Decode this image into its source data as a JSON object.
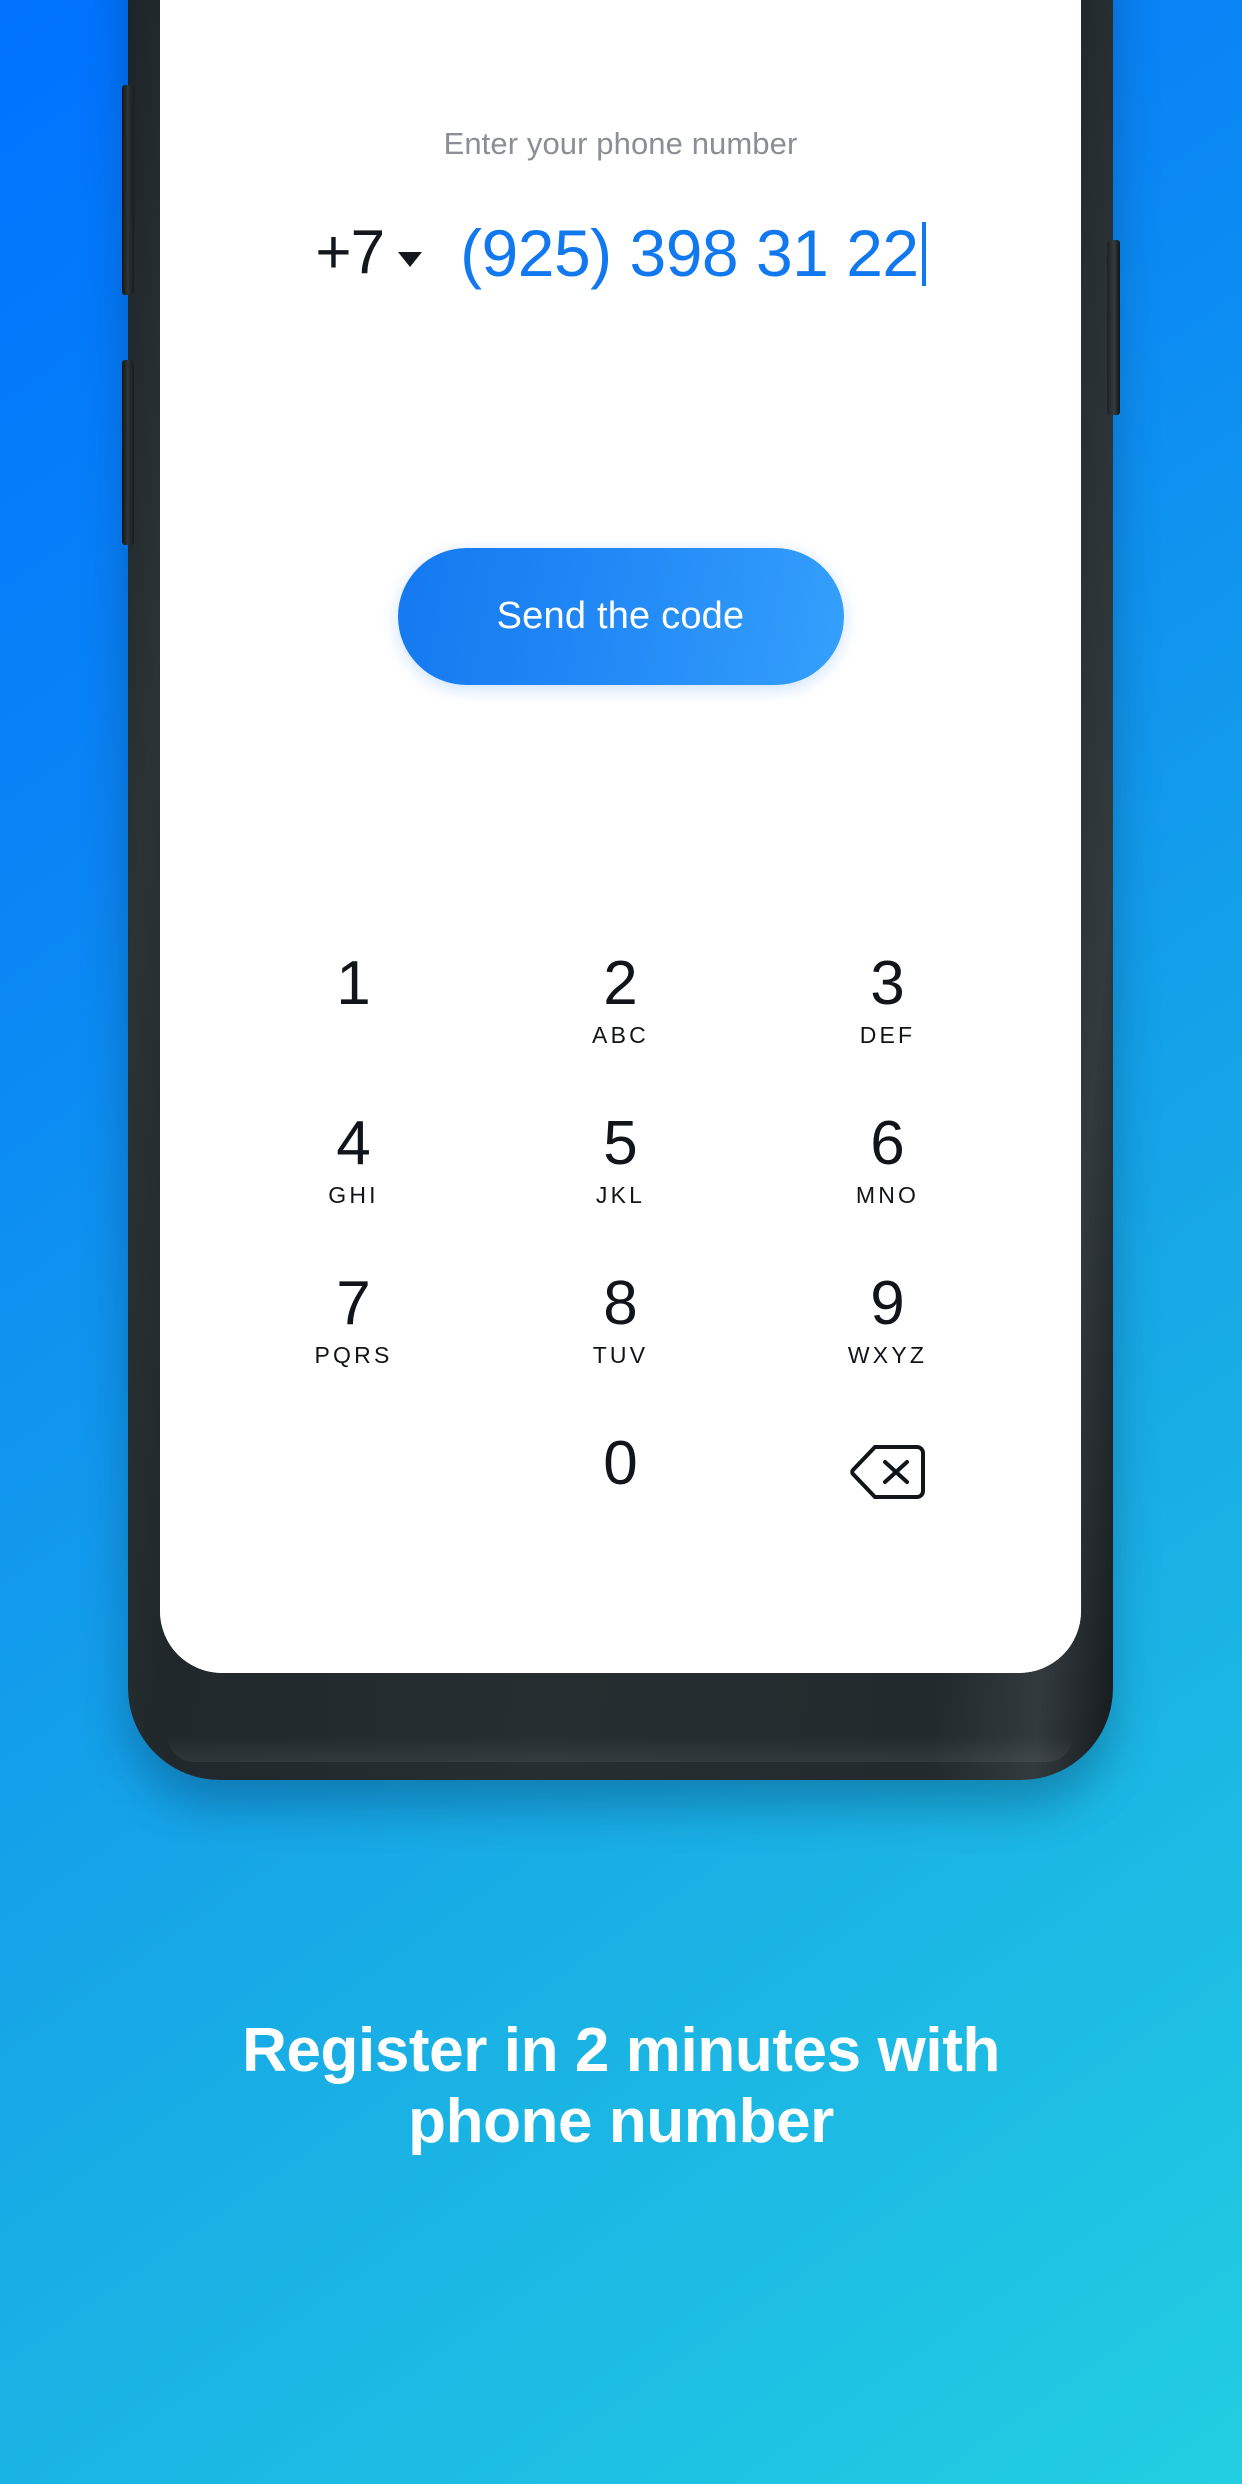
{
  "background": {
    "gradient_from": "#0072FF",
    "gradient_to": "#22CEE1"
  },
  "phone_screen": {
    "hint_label": "Enter your phone number",
    "country_code": "+7",
    "country_code_caret": "chevron-down-icon",
    "phone_number": "(925) 398 31 22",
    "send_button_label": "Send the code",
    "send_button_color": "#2289F6",
    "number_color": "#1178EF",
    "keypad": [
      {
        "digit": "1",
        "letters": ""
      },
      {
        "digit": "2",
        "letters": "ABC"
      },
      {
        "digit": "3",
        "letters": "DEF"
      },
      {
        "digit": "4",
        "letters": "GHI"
      },
      {
        "digit": "5",
        "letters": "JKL"
      },
      {
        "digit": "6",
        "letters": "MNO"
      },
      {
        "digit": "7",
        "letters": "PQRS"
      },
      {
        "digit": "8",
        "letters": "TUV"
      },
      {
        "digit": "9",
        "letters": "WXYZ"
      },
      {
        "digit": "0",
        "letters": ""
      }
    ],
    "backspace_icon": "backspace-icon"
  },
  "caption": {
    "line1": "Register in 2 minutes with",
    "line2": "phone number",
    "color": "#FFFFFF"
  }
}
